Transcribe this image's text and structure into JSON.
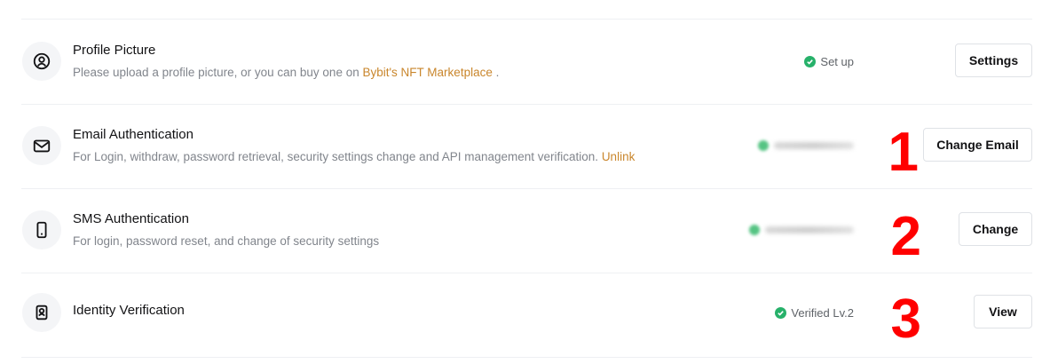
{
  "rows": [
    {
      "title": "Profile Picture",
      "description_text": "Please upload a profile picture, or you can buy one on ",
      "description_link": "Bybit's NFT Marketplace",
      "description_suffix": " .",
      "status": "Set up",
      "button": "Settings",
      "icon": "user-circle-icon",
      "annotation": ""
    },
    {
      "title": "Email Authentication",
      "description_text": "For Login, withdraw, password retrieval, security settings change and API management verification. ",
      "description_link": "Unlink",
      "status": "",
      "button": "Change Email",
      "icon": "mail-icon",
      "annotation": "1"
    },
    {
      "title": "SMS Authentication",
      "description_text": "For login, password reset, and change of security settings",
      "status": "",
      "button": "Change",
      "icon": "mobile-phone-icon",
      "annotation": "2"
    },
    {
      "title": "Identity Verification",
      "description_text": "",
      "status": "Verified Lv.2",
      "button": "View",
      "icon": "id-badge-icon",
      "annotation": "3"
    }
  ],
  "colors": {
    "link": "#c9862c",
    "success": "#27b16a",
    "annotation": "#ff0000"
  }
}
